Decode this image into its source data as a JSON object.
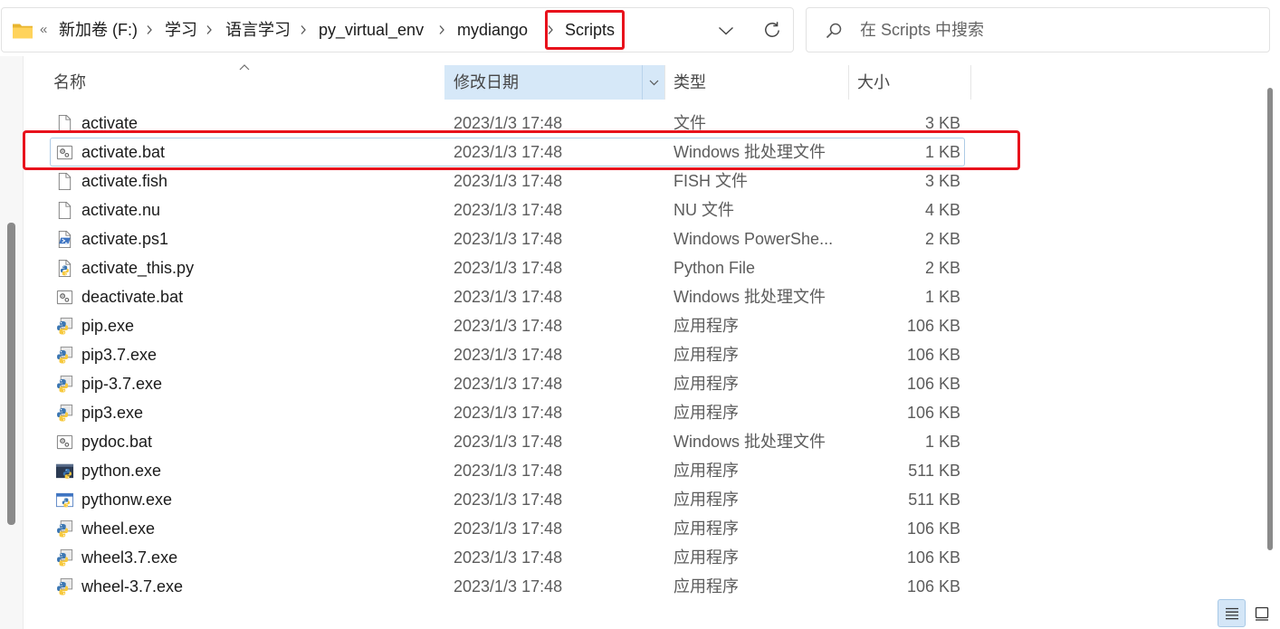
{
  "address_bar": {
    "folder_icon": "folder-icon",
    "overflow_glyph": "«",
    "breadcrumbs": [
      "新加卷 (F:)",
      "学习",
      "语言学习",
      "py_virtual_env",
      "mydiango",
      "Scripts"
    ],
    "separator_icon": "chevron-right-icon",
    "history_icon": "chevron-down-icon",
    "refresh_icon": "refresh-icon"
  },
  "search": {
    "icon": "search-icon",
    "placeholder": "在 Scripts 中搜索"
  },
  "columns": {
    "name": "名称",
    "modified": "修改日期",
    "type": "类型",
    "size": "大小",
    "sort_icon": "chevron-up-icon",
    "filter_icon": "chevron-down-icon"
  },
  "files": [
    {
      "name": "activate",
      "modified": "2023/1/3 17:48",
      "type": "文件",
      "size": "3 KB",
      "icon": "file-icon"
    },
    {
      "name": "activate.bat",
      "modified": "2023/1/3 17:48",
      "type": "Windows 批处理文件",
      "size": "1 KB",
      "icon": "batch-file-icon",
      "focused": true
    },
    {
      "name": "activate.fish",
      "modified": "2023/1/3 17:48",
      "type": "FISH 文件",
      "size": "3 KB",
      "icon": "file-icon"
    },
    {
      "name": "activate.nu",
      "modified": "2023/1/3 17:48",
      "type": "NU 文件",
      "size": "4 KB",
      "icon": "file-icon"
    },
    {
      "name": "activate.ps1",
      "modified": "2023/1/3 17:48",
      "type": "Windows PowerShe...",
      "size": "2 KB",
      "icon": "powershell-script-icon"
    },
    {
      "name": "activate_this.py",
      "modified": "2023/1/3 17:48",
      "type": "Python File",
      "size": "2 KB",
      "icon": "python-script-icon"
    },
    {
      "name": "deactivate.bat",
      "modified": "2023/1/3 17:48",
      "type": "Windows 批处理文件",
      "size": "1 KB",
      "icon": "batch-file-icon"
    },
    {
      "name": "pip.exe",
      "modified": "2023/1/3 17:48",
      "type": "应用程序",
      "size": "106 KB",
      "icon": "python-launcher-icon"
    },
    {
      "name": "pip3.7.exe",
      "modified": "2023/1/3 17:48",
      "type": "应用程序",
      "size": "106 KB",
      "icon": "python-launcher-icon"
    },
    {
      "name": "pip-3.7.exe",
      "modified": "2023/1/3 17:48",
      "type": "应用程序",
      "size": "106 KB",
      "icon": "python-launcher-icon"
    },
    {
      "name": "pip3.exe",
      "modified": "2023/1/3 17:48",
      "type": "应用程序",
      "size": "106 KB",
      "icon": "python-launcher-icon"
    },
    {
      "name": "pydoc.bat",
      "modified": "2023/1/3 17:48",
      "type": "Windows 批处理文件",
      "size": "1 KB",
      "icon": "batch-file-icon"
    },
    {
      "name": "python.exe",
      "modified": "2023/1/3 17:48",
      "type": "应用程序",
      "size": "511 KB",
      "icon": "python-console-icon"
    },
    {
      "name": "pythonw.exe",
      "modified": "2023/1/3 17:48",
      "type": "应用程序",
      "size": "511 KB",
      "icon": "python-window-icon"
    },
    {
      "name": "wheel.exe",
      "modified": "2023/1/3 17:48",
      "type": "应用程序",
      "size": "106 KB",
      "icon": "python-launcher-icon"
    },
    {
      "name": "wheel3.7.exe",
      "modified": "2023/1/3 17:48",
      "type": "应用程序",
      "size": "106 KB",
      "icon": "python-launcher-icon"
    },
    {
      "name": "wheel-3.7.exe",
      "modified": "2023/1/3 17:48",
      "type": "应用程序",
      "size": "106 KB",
      "icon": "python-launcher-icon"
    }
  ],
  "view_buttons": [
    {
      "icon": "details-view-icon",
      "active": true
    },
    {
      "icon": "large-icons-view-icon",
      "active": false
    }
  ],
  "colors": {
    "header_highlight": "#d6e8f8",
    "annotation": "#e8121c",
    "secondary_text": "#5c5c5c",
    "scrollbar_thumb": "#8a8a8a"
  }
}
